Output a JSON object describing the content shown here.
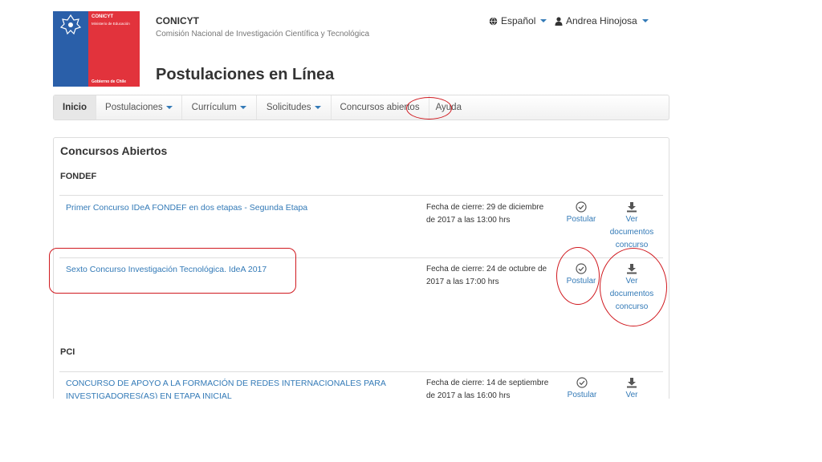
{
  "logo": {
    "brand": "CONICYT",
    "ministry": "Ministerio de Educación",
    "government": "Gobierno de Chile"
  },
  "header": {
    "org": "CONICYT",
    "org_full": "Comisión Nacional de Investigación Científica y Tecnológica",
    "title": "Postulaciones en Línea",
    "language": "Español",
    "user": "Andrea Hinojosa"
  },
  "nav": {
    "items": [
      {
        "label": "Inicio"
      },
      {
        "label": "Postulaciones"
      },
      {
        "label": "Currículum"
      },
      {
        "label": "Solicitudes"
      },
      {
        "label": "Concursos abiertos"
      },
      {
        "label": "Ayuda"
      }
    ]
  },
  "panel": {
    "title": "Concursos Abiertos",
    "sections": [
      {
        "name": "FONDEF",
        "contests": [
          {
            "title": "Primer Concurso IDeA FONDEF en dos etapas - Segunda Etapa",
            "deadline_l1": "Fecha de cierre: 29 de diciembre",
            "deadline_l2": "de 2017 a las 13:00 hrs",
            "apply": "Postular",
            "docs_l1": "Ver",
            "docs_l2": "documentos",
            "docs_l3": "concurso"
          },
          {
            "title": "Sexto Concurso Investigación Tecnológica. IdeA 2017",
            "deadline_l1": "Fecha de cierre: 24 de octubre de",
            "deadline_l2": "2017 a las 17:00 hrs",
            "apply": "Postular",
            "docs_l1": "Ver",
            "docs_l2": "documentos",
            "docs_l3": "concurso"
          }
        ]
      },
      {
        "name": "PCI",
        "contests": [
          {
            "title_l1": "CONCURSO DE APOYO A LA FORMACIÓN DE REDES INTERNACIONALES PARA",
            "title_l2": "INVESTIGADORES(AS) EN ETAPA INICIAL",
            "deadline_l1": "Fecha de cierre: 14 de septiembre",
            "deadline_l2": "de 2017 a las 16:00 hrs",
            "apply": "Postular",
            "docs_l1": "Ver"
          }
        ]
      }
    ]
  },
  "colors": {
    "link": "#337ab7",
    "annotation": "#d0191f",
    "logo_blue": "#2a5fa9",
    "logo_red": "#e2333c"
  }
}
